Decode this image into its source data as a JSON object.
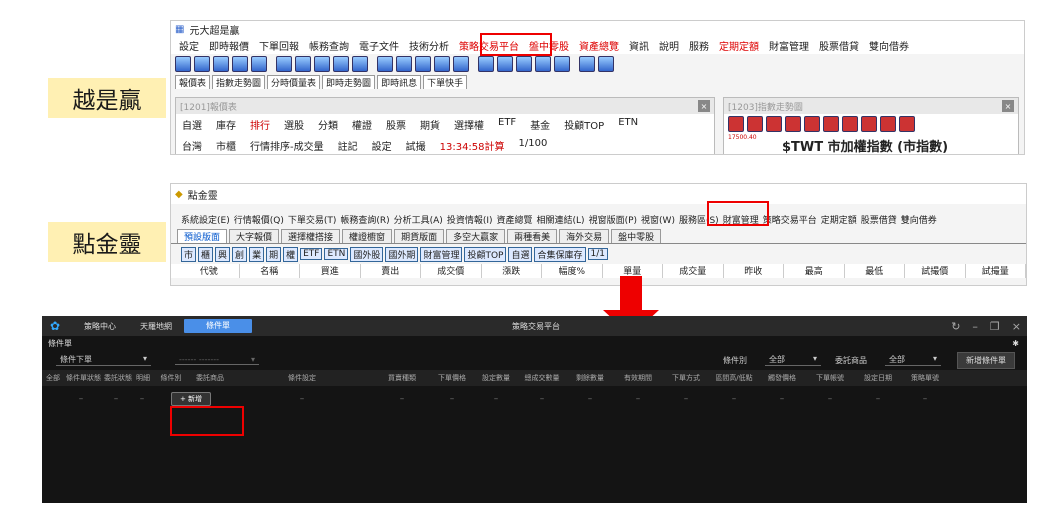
{
  "labels": {
    "top": "越是贏",
    "mid": "點金靈"
  },
  "s1": {
    "title": "元大超是贏",
    "menu": [
      "設定",
      "即時報價",
      "下單回報",
      "帳務查詢",
      "電子文件",
      "技術分析",
      "策略交易平台",
      "盤中零股",
      "資產總覽",
      "資訊",
      "說明",
      "服務",
      "定期定額",
      "財富管理",
      "股票借貸",
      "雙向借券"
    ],
    "tabs": [
      "報價表",
      "指數走勢圖",
      "分時價量表",
      "即時走勢圖",
      "即時訊息",
      "下單快手"
    ],
    "pane1_title": "[1201]報價表",
    "pane1_row1": [
      "自選",
      "庫存",
      "排行",
      "選股",
      "分類",
      "權證",
      "股票",
      "期貨",
      "選擇權",
      "ETF",
      "基金",
      "投顧TOP",
      "ETN"
    ],
    "pane1_row2": [
      "台灣",
      "市櫃",
      "行情排序-成交量",
      "註記",
      "設定",
      "試撮",
      "13:34:58計算",
      "1/100"
    ],
    "pane2_title": "[1203]指數走勢圖",
    "pane2_text": "$TWT 市加權指數 (市指數)",
    "pane2_num": "17500.40"
  },
  "s2": {
    "title": "點金靈",
    "menu": [
      "系統設定(E)",
      "行情報價(Q)",
      "下單交易(T)",
      "帳務查詢(R)",
      "分析工具(A)",
      "投資情報(I)",
      "資產總覽",
      "相關連結(L)",
      "視窗版面(P)",
      "視窗(W)",
      "服務區(S)",
      "財富管理",
      "策略交易平台",
      "定期定額",
      "股票借貸",
      "雙向借券"
    ],
    "tabs": [
      "預設版面",
      "大字報價",
      "選擇權搭接",
      "權證櫥窗",
      "期貨版面",
      "多空大贏家",
      "兩種看美",
      "海外交易",
      "盤中零股"
    ],
    "toolbar": [
      "市",
      "櫃",
      "興",
      "創",
      "業",
      "期",
      "權",
      "ETF",
      "ETN",
      "國外股",
      "國外期",
      "財富管理",
      "投顧TOP",
      "自選",
      "合集保庫存",
      "1/1"
    ],
    "headers": [
      "代號",
      "名稱",
      "買進",
      "賣出",
      "成交價",
      "漲跌",
      "幅度%",
      "單量",
      "成交量",
      "昨收",
      "最高",
      "最低",
      "試撮價",
      "試撮量"
    ]
  },
  "s3": {
    "nav": [
      "策略中心",
      "天羅地網",
      "條件單"
    ],
    "title": "策略交易平台",
    "section": "條件單",
    "filter": {
      "type": "條件下單",
      "type2": "------ -------",
      "cat_label": "條件別",
      "cat_val": "全部",
      "item_label": "委託商品",
      "item_val": "全部",
      "new_btn": "新增條件單"
    },
    "headers": [
      "全部",
      "條件單狀態",
      "委託狀態",
      "明細",
      "條件別",
      "委託商品",
      "條件設定",
      "買賣種類",
      "下單價格",
      "設定數量",
      "總成交數量",
      "剩餘數量",
      "有效期間",
      "下單方式",
      "區間高/低點",
      "觸發價格",
      "下單帳號",
      "設定日期",
      "策略單號"
    ],
    "add_btn": "+ 新增",
    "dash": "–"
  }
}
